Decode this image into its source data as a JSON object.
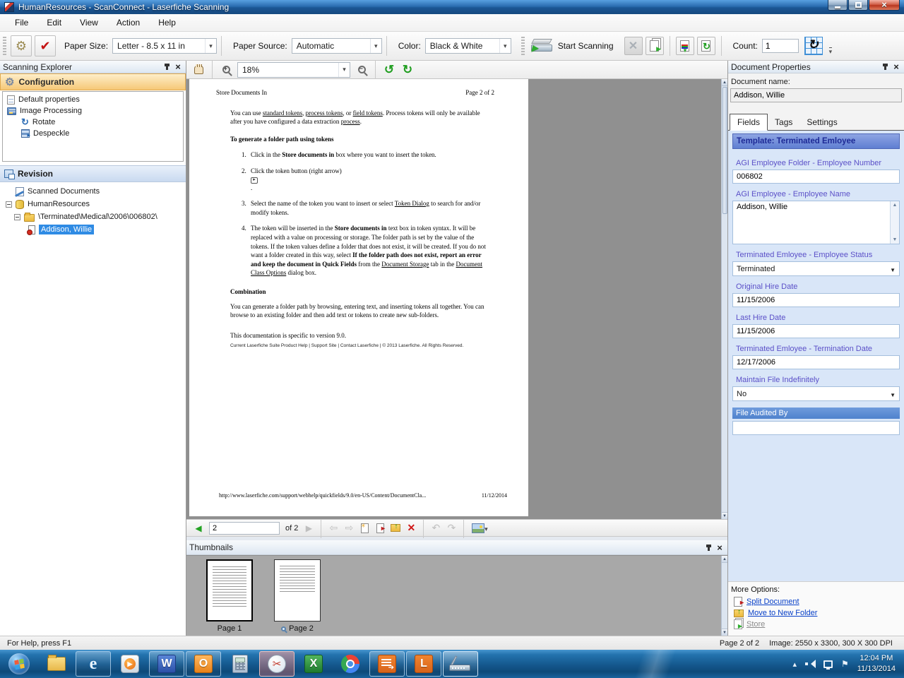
{
  "window": {
    "title": "HumanResources - ScanConnect - Laserfiche Scanning"
  },
  "menu": {
    "items": [
      "File",
      "Edit",
      "View",
      "Action",
      "Help"
    ]
  },
  "toolbar": {
    "paper_size_label": "Paper Size:",
    "paper_size_value": "Letter - 8.5 x 11 in",
    "paper_source_label": "Paper Source:",
    "paper_source_value": "Automatic",
    "color_label": "Color:",
    "color_value": "Black & White",
    "start_scanning": "Start Scanning",
    "count_label": "Count:",
    "count_value": "1"
  },
  "explorer": {
    "title": "Scanning Explorer",
    "configuration": {
      "header": "Configuration",
      "items": [
        "Default properties",
        "Image Processing",
        "Rotate",
        "Despeckle"
      ]
    },
    "revision": {
      "header": "Revision",
      "items": [
        "Scanned Documents",
        "HumanResources",
        "\\Terminated\\Medical\\2006\\006802\\",
        "Addison, Willie"
      ]
    }
  },
  "viewer": {
    "zoom": "18%"
  },
  "page": {
    "header_left": "Store Documents In",
    "header_right": "Page 2 of 2",
    "intro": {
      "t1": "You can use ",
      "l1": "standard tokens",
      "t2": ", ",
      "l2": "process tokens",
      "t3": ", or ",
      "l3": "field tokens",
      "t4": ". Process tokens will only be available after you have configured a data extraction ",
      "l4": "process",
      "t5": "."
    },
    "heading": "To generate a folder path using tokens",
    "steps": {
      "s1": {
        "num": "1.",
        "t1": "Click in the ",
        "b": "Store documents in",
        "t2": " box where you want to insert the token."
      },
      "s2": {
        "num": "2.",
        "t1": "Click the token button (right arrow)",
        "dot": "."
      },
      "s3": {
        "num": "3.",
        "t1": "Select the name of the token you want to insert or select ",
        "l": "Token Dialog",
        "t2": " to search for and/or modify tokens."
      },
      "s4": {
        "num": "4.",
        "t1": "The token will be inserted in the ",
        "b1": "Store documents in",
        "t2": " text box in token syntax. It will be replaced with a value on processing or storage. The folder path is set by the value of the tokens. If the token values define a folder that does not exist, it will be created. If you do not want a folder created in this way, select ",
        "b2": "If the folder path does not exist, report an error and keep the document in Quick Fields",
        "t3": " from the ",
        "l1": "Document Storage",
        "t4": " tab in the ",
        "l2": "Document Class Options",
        "t5": " dialog box."
      }
    },
    "combination_heading": "Combination",
    "combination_text": "You can generate a folder path by browsing, entering text, and inserting tokens all together. You can browse to an existing folder and then add text or tokens to create new sub-folders.",
    "version_note": "This documentation is specific to version 9.0.",
    "footer": "Current Laserfiche Suite Product Help | Support Site | Contact Laserfiche | © 2013 Laserfiche. All Rights Reserved.",
    "url": "http://www.laserfiche.com/support/webhelp/quickfields/9.0/en-US/Content/DocumentCla...",
    "url_date": "11/12/2014"
  },
  "pagenav": {
    "page_value": "2",
    "of_label": "of 2"
  },
  "thumbnails": {
    "title": "Thumbnails",
    "page1_label": "Page 1",
    "page2_label": "Page 2"
  },
  "properties": {
    "title": "Document Properties",
    "doc_name_label": "Document name:",
    "doc_name_value": "Addison, Willie",
    "tabs": [
      "Fields",
      "Tags",
      "Settings"
    ],
    "template_header": "Template: Terminated Emloyee",
    "fields": [
      {
        "label": "AGI Employee Folder - Employee Number",
        "value": "006802"
      },
      {
        "label": "AGI Employee - Employee Name",
        "value": "Addison, Willie"
      },
      {
        "label": "Terminated Emloyee - Employee Status",
        "value": "Terminated"
      },
      {
        "label": "Original Hire Date",
        "value": "11/15/2006"
      },
      {
        "label": "Last Hire Date",
        "value": "11/15/2006"
      },
      {
        "label": "Terminated Emloyee - Termination Date",
        "value": "12/17/2006"
      },
      {
        "label": "Maintain File Indefinitely",
        "value": "No"
      },
      {
        "label": "File Audited By",
        "value": ""
      }
    ],
    "more_options_label": "More Options:",
    "links": [
      "Split Document",
      "Move to New Folder",
      "Store"
    ]
  },
  "statusbar": {
    "left": "For Help, press F1",
    "page": "Page 2 of 2",
    "image_info": "Image: 2550 x 3300, 300 X 300 DPI"
  },
  "taskbar": {
    "word_glyph": "W",
    "outlook_glyph": "O",
    "excel_glyph": "X",
    "laserfiche_glyph": "L",
    "ie_glyph": "e",
    "wmp_glyph": "▶",
    "time": "12:04 PM",
    "date": "11/13/2014"
  }
}
